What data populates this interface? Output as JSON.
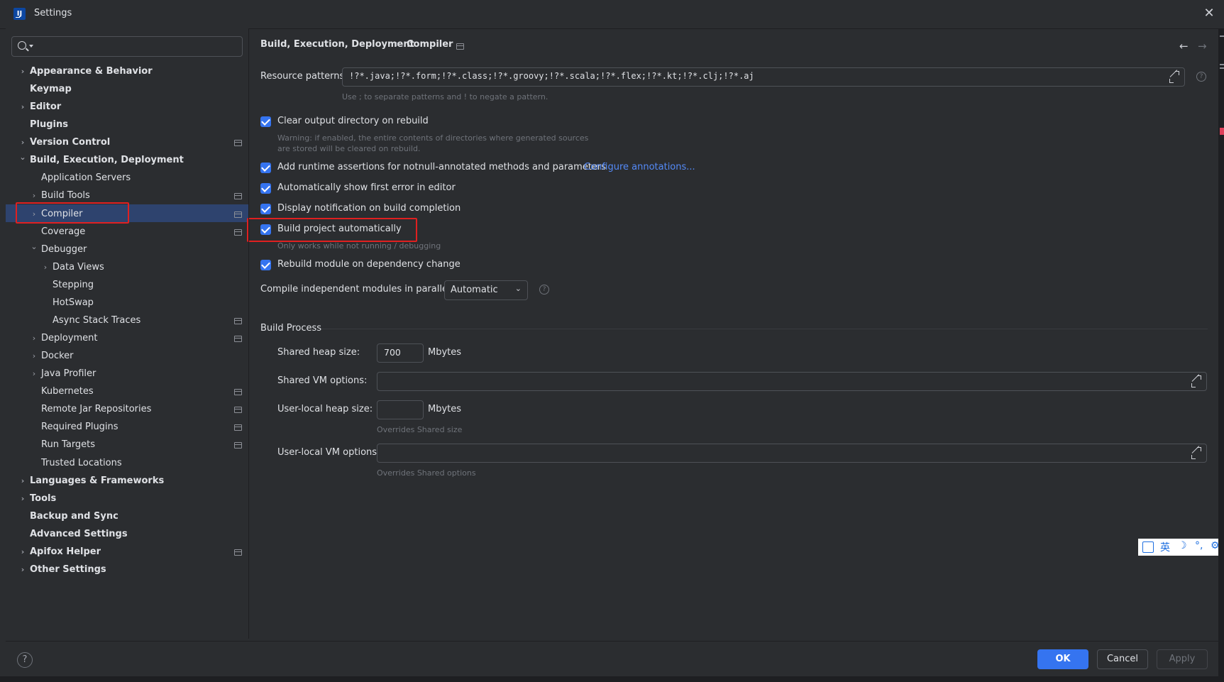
{
  "window": {
    "title": "Settings"
  },
  "search": {
    "placeholder": ""
  },
  "sidebar": {
    "items": [
      {
        "label": "Appearance & Behavior",
        "bold": true,
        "level": 0,
        "chevron": "right",
        "project_icon": false
      },
      {
        "label": "Keymap",
        "bold": true,
        "level": 0,
        "chevron": "none",
        "project_icon": false
      },
      {
        "label": "Editor",
        "bold": true,
        "level": 0,
        "chevron": "right",
        "project_icon": false
      },
      {
        "label": "Plugins",
        "bold": true,
        "level": 0,
        "chevron": "none",
        "project_icon": false
      },
      {
        "label": "Version Control",
        "bold": true,
        "level": 0,
        "chevron": "right",
        "project_icon": true
      },
      {
        "label": "Build, Execution, Deployment",
        "bold": true,
        "level": 0,
        "chevron": "down",
        "project_icon": false
      },
      {
        "label": "Application Servers",
        "bold": false,
        "level": 1,
        "chevron": "none",
        "project_icon": false
      },
      {
        "label": "Build Tools",
        "bold": false,
        "level": 1,
        "chevron": "right",
        "project_icon": true
      },
      {
        "label": "Compiler",
        "bold": false,
        "level": 1,
        "chevron": "right",
        "project_icon": true,
        "selected": true
      },
      {
        "label": "Coverage",
        "bold": false,
        "level": 1,
        "chevron": "none",
        "project_icon": true
      },
      {
        "label": "Debugger",
        "bold": false,
        "level": 1,
        "chevron": "down",
        "project_icon": false
      },
      {
        "label": "Data Views",
        "bold": false,
        "level": 2,
        "chevron": "right",
        "project_icon": false
      },
      {
        "label": "Stepping",
        "bold": false,
        "level": 2,
        "chevron": "none",
        "project_icon": false
      },
      {
        "label": "HotSwap",
        "bold": false,
        "level": 2,
        "chevron": "none",
        "project_icon": false
      },
      {
        "label": "Async Stack Traces",
        "bold": false,
        "level": 2,
        "chevron": "none",
        "project_icon": true
      },
      {
        "label": "Deployment",
        "bold": false,
        "level": 1,
        "chevron": "right",
        "project_icon": true
      },
      {
        "label": "Docker",
        "bold": false,
        "level": 1,
        "chevron": "right",
        "project_icon": false
      },
      {
        "label": "Java Profiler",
        "bold": false,
        "level": 1,
        "chevron": "right",
        "project_icon": false
      },
      {
        "label": "Kubernetes",
        "bold": false,
        "level": 1,
        "chevron": "none",
        "project_icon": true
      },
      {
        "label": "Remote Jar Repositories",
        "bold": false,
        "level": 1,
        "chevron": "none",
        "project_icon": true
      },
      {
        "label": "Required Plugins",
        "bold": false,
        "level": 1,
        "chevron": "none",
        "project_icon": true
      },
      {
        "label": "Run Targets",
        "bold": false,
        "level": 1,
        "chevron": "none",
        "project_icon": true
      },
      {
        "label": "Trusted Locations",
        "bold": false,
        "level": 1,
        "chevron": "none",
        "project_icon": false
      },
      {
        "label": "Languages & Frameworks",
        "bold": true,
        "level": 0,
        "chevron": "right",
        "project_icon": false
      },
      {
        "label": "Tools",
        "bold": true,
        "level": 0,
        "chevron": "right",
        "project_icon": false
      },
      {
        "label": "Backup and Sync",
        "bold": true,
        "level": 0,
        "chevron": "none",
        "project_icon": false
      },
      {
        "label": "Advanced Settings",
        "bold": true,
        "level": 0,
        "chevron": "none",
        "project_icon": false
      },
      {
        "label": "Apifox Helper",
        "bold": true,
        "level": 0,
        "chevron": "right",
        "project_icon": true
      },
      {
        "label": "Other Settings",
        "bold": true,
        "level": 0,
        "chevron": "right",
        "project_icon": false
      }
    ]
  },
  "breadcrumb": {
    "parent": "Build, Execution, Deployment",
    "separator": "›",
    "current": "Compiler"
  },
  "nav": {
    "back": "←",
    "forward": "→"
  },
  "resource_patterns": {
    "label": "Resource patterns:",
    "value": "!?*.java;!?*.form;!?*.class;!?*.groovy;!?*.scala;!?*.flex;!?*.kt;!?*.clj;!?*.aj",
    "hint": "Use ; to separate patterns and ! to negate a pattern."
  },
  "options": {
    "clear_output": {
      "label": "Clear output directory on rebuild",
      "checked": true,
      "hint_line1": "Warning: if enabled, the entire contents of directories where generated sources",
      "hint_line2": "are stored will be cleared on rebuild."
    },
    "runtime_assertions": {
      "label": "Add runtime assertions for notnull-annotated methods and parameters",
      "checked": true,
      "link": "Configure annotations..."
    },
    "show_first_error": {
      "label": "Automatically show first error in editor",
      "checked": true
    },
    "display_notification": {
      "label": "Display notification on build completion",
      "checked": true
    },
    "build_automatically": {
      "label": "Build project automatically",
      "checked": true,
      "hint": "Only works while not running / debugging"
    },
    "rebuild_module": {
      "label": "Rebuild module on dependency change",
      "checked": true
    }
  },
  "parallel": {
    "label": "Compile independent modules in parallel:",
    "selected": "Automatic"
  },
  "build_process": {
    "section_title": "Build Process",
    "shared_heap_label": "Shared heap size:",
    "shared_heap_value": "700",
    "shared_heap_unit": "Mbytes",
    "shared_vm_label": "Shared VM options:",
    "shared_vm_value": "",
    "user_heap_label": "User-local heap size:",
    "user_heap_value": "",
    "user_heap_unit": "Mbytes",
    "user_heap_hint": "Overrides Shared size",
    "user_vm_label": "User-local VM options:",
    "user_vm_value": "",
    "user_vm_hint": "Overrides Shared options"
  },
  "footer": {
    "help": "?",
    "ok": "OK",
    "cancel": "Cancel",
    "apply": "Apply"
  },
  "ime_bar": {
    "lang": "英",
    "moon": "☽",
    "punct": "°,",
    "gear": "⚙"
  },
  "colors": {
    "accent": "#3574f0",
    "selection": "#2e436e",
    "link": "#548af7",
    "highlight_box": "#e02020"
  }
}
